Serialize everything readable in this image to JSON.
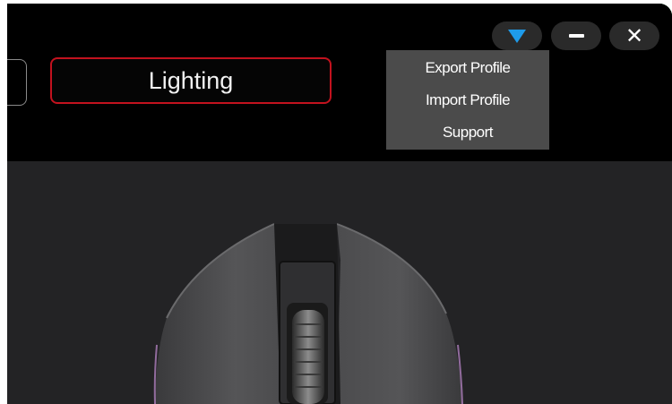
{
  "tabs": {
    "lighting_label": "Lighting"
  },
  "window_controls": {
    "dropdown_icon": "triangle-down-icon",
    "minimize_icon": "minus-icon",
    "close_icon": "close-icon",
    "close_glyph": "✕",
    "accent_color": "#1e9bea"
  },
  "menu": {
    "items": [
      "Export Profile",
      "Import Profile",
      "Support"
    ]
  },
  "colors": {
    "active_tab_border": "#c2121e",
    "corner_accent": "#2bd25a"
  }
}
